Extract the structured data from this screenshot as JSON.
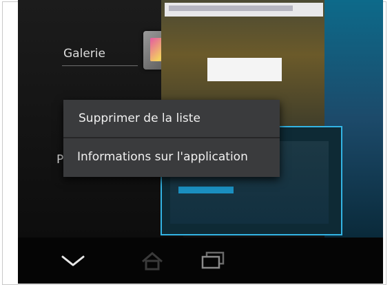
{
  "launcher": {
    "app_label": "Galerie",
    "partial_label": "P"
  },
  "context_menu": {
    "items": [
      {
        "label": "Supprimer de la liste"
      },
      {
        "label": "Informations sur l'application"
      }
    ]
  },
  "nav_bar": {
    "back_icon": "chevron-down-icon",
    "home_icon": "home-icon",
    "recents_icon": "recent-apps-icon"
  },
  "colors": {
    "accent": "#33b5e5",
    "menu_background": "#3a3b3d",
    "nav_background": "#050505"
  }
}
